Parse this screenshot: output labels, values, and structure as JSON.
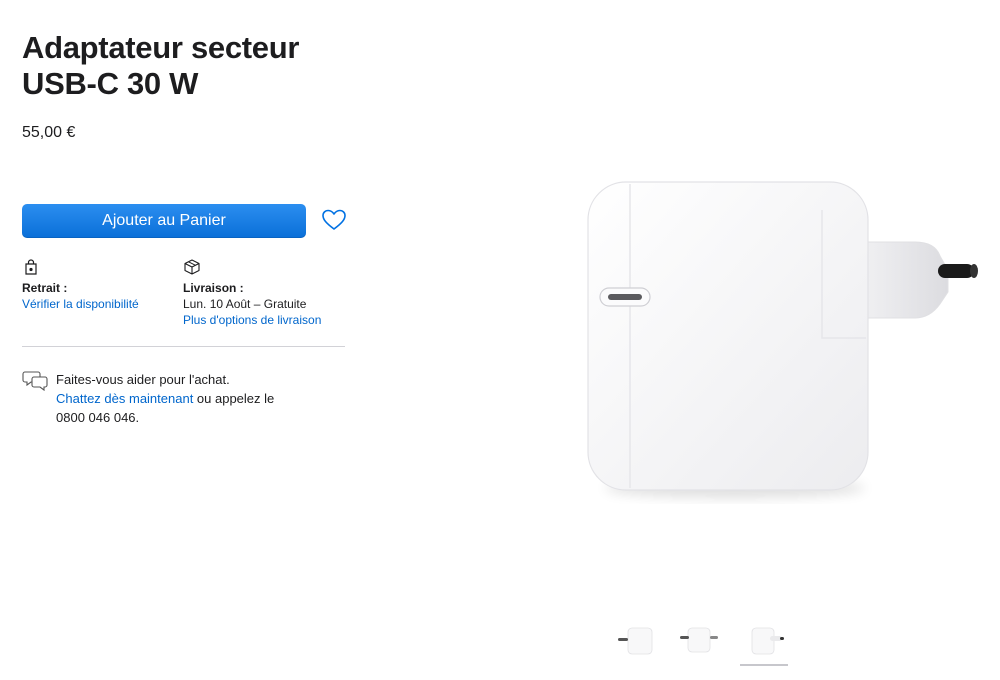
{
  "product": {
    "title_line1": "Adaptateur secteur",
    "title_line2": "USB-C 30 W",
    "price": "55,00 €",
    "image_icon": "usb-c-power-adapter-image"
  },
  "actions": {
    "add_to_bag": "Ajouter au Panier",
    "favorite_icon": "heart-icon"
  },
  "pickup": {
    "icon": "store-bag-icon",
    "label": "Retrait :",
    "link": "Vérifier la disponibilité"
  },
  "delivery": {
    "icon": "box-icon",
    "label": "Livraison :",
    "date": "Lun. 10 Août – Gratuite",
    "link": "Plus d'options de livraison"
  },
  "help": {
    "icon": "chat-bubbles-icon",
    "line1": "Faites-vous aider pour l'achat.",
    "link": "Chattez dès maintenant",
    "after_link": " ou appelez le",
    "phone": "0800 046 046."
  },
  "gallery": {
    "selected_index": 2,
    "thumbnails": [
      "thumbnail-1",
      "thumbnail-2",
      "thumbnail-3"
    ]
  },
  "colors": {
    "accent": "#0071e3",
    "link": "#0066cc",
    "text": "#1d1d1f"
  }
}
